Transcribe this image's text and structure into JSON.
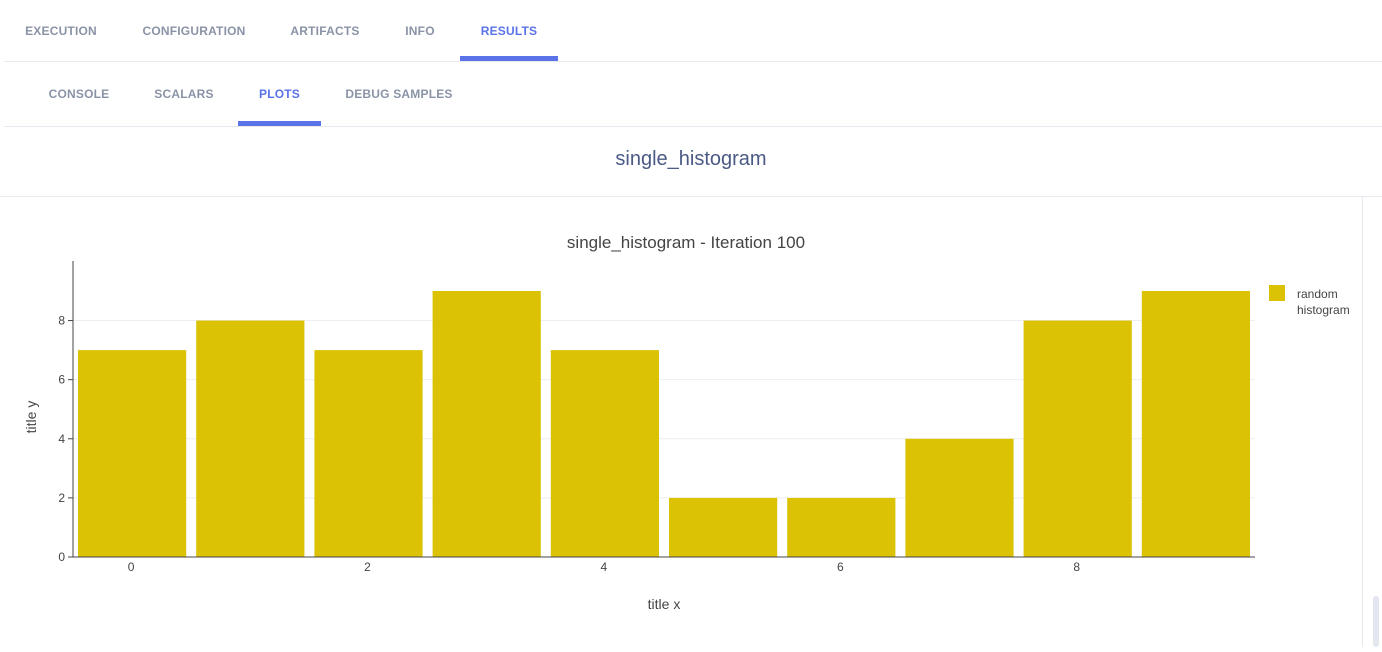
{
  "top_tabs": [
    {
      "label": "EXECUTION",
      "active": false
    },
    {
      "label": "CONFIGURATION",
      "active": false
    },
    {
      "label": "ARTIFACTS",
      "active": false
    },
    {
      "label": "INFO",
      "active": false
    },
    {
      "label": "RESULTS",
      "active": true
    }
  ],
  "sub_tabs": [
    {
      "label": "CONSOLE",
      "active": false
    },
    {
      "label": "SCALARS",
      "active": false
    },
    {
      "label": "PLOTS",
      "active": true
    },
    {
      "label": "DEBUG SAMPLES",
      "active": false
    }
  ],
  "plot_section": {
    "title": "single_histogram"
  },
  "colors": {
    "accent": "#5a73e8",
    "bar": "#dbc204"
  },
  "chart_data": {
    "type": "bar",
    "title": "single_histogram - Iteration 100",
    "xlabel": "title x",
    "ylabel": "title y",
    "x": [
      0,
      1,
      2,
      3,
      4,
      5,
      6,
      7,
      8,
      9
    ],
    "series": [
      {
        "name": "random histogram",
        "values": [
          7,
          8,
          7,
          9,
          7,
          2,
          2,
          4,
          8,
          9
        ]
      }
    ],
    "legend_label_lines": [
      "random",
      "histogram"
    ],
    "legend_position": "top-right",
    "x_ticks": [
      0,
      2,
      4,
      6,
      8
    ],
    "y_ticks": [
      0,
      2,
      4,
      6,
      8
    ],
    "ylim": [
      0,
      9
    ],
    "grid": true
  }
}
